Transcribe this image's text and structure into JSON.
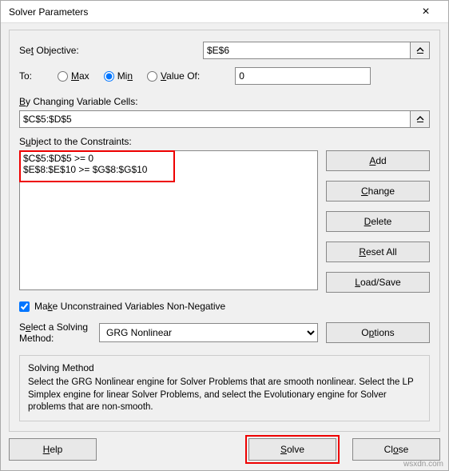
{
  "title": "Solver Parameters",
  "objective": {
    "label": "Set Objective:",
    "label_accesskey": "t",
    "value": "$E$6"
  },
  "to": {
    "label": "To:",
    "max": "Max",
    "min": "Min",
    "valueof": "Value Of:",
    "value": "0",
    "selected": "min"
  },
  "changing": {
    "label": "By Changing Variable Cells:",
    "value": "$C$5:$D$5"
  },
  "constraints": {
    "label": "Subject to the Constraints:",
    "label_accesskey": "u",
    "items": [
      "$C$5:$D$5 >= 0",
      "$E$8:$E$10 >= $G$8:$G$10"
    ]
  },
  "buttons": {
    "add": "Add",
    "change": "Change",
    "delete": "Delete",
    "resetall": "Reset All",
    "loadsave": "Load/Save",
    "options": "Options",
    "help": "Help",
    "solve": "Solve",
    "close": "Close"
  },
  "unconstrained": {
    "label": "Make Unconstrained Variables Non-Negative",
    "checked": true
  },
  "method": {
    "label": "Select a Solving Method:",
    "label_accesskey": "E",
    "value": "GRG Nonlinear"
  },
  "info": {
    "header": "Solving Method",
    "text": "Select the GRG Nonlinear engine for Solver Problems that are smooth nonlinear. Select the LP Simplex engine for linear Solver Problems, and select the Evolutionary engine for Solver problems that are non-smooth."
  },
  "watermark": "wsxdn.com"
}
